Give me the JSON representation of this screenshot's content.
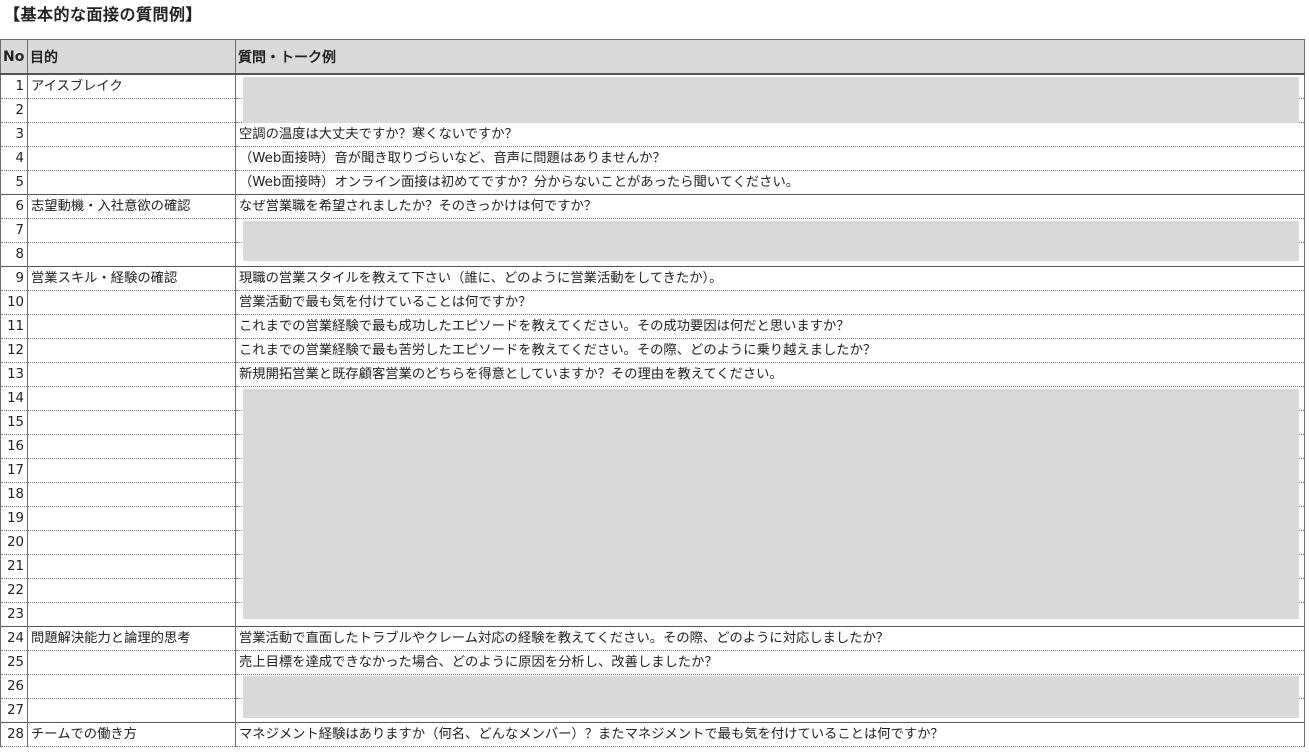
{
  "title": "【基本的な面接の質問例】",
  "table": {
    "headers": [
      "No",
      "目的",
      "質問・トーク例"
    ],
    "rows": [
      {
        "no": "1",
        "purpose": "アイスブレイク",
        "question": "",
        "group_start": true
      },
      {
        "no": "2",
        "purpose": "",
        "question": ""
      },
      {
        "no": "3",
        "purpose": "",
        "question": "空調の温度は大丈夫ですか？寒くないですか？"
      },
      {
        "no": "4",
        "purpose": "",
        "question": "（Web面接時）音が聞き取りづらいなど、音声に問題はありませんか？"
      },
      {
        "no": "5",
        "purpose": "",
        "question": "（Web面接時）オンライン面接は初めてですか？分からないことがあったら聞いてください。"
      },
      {
        "no": "6",
        "purpose": "志望動機・入社意欲の確認",
        "question": "なぜ営業職を希望されましたか？そのきっかけは何ですか？",
        "group_start": true
      },
      {
        "no": "7",
        "purpose": "",
        "question": ""
      },
      {
        "no": "8",
        "purpose": "",
        "question": ""
      },
      {
        "no": "9",
        "purpose": "営業スキル・経験の確認",
        "question": "現職の営業スタイルを教えて下さい（誰に、どのように営業活動をしてきたか）。",
        "group_start": true
      },
      {
        "no": "10",
        "purpose": "",
        "question": "営業活動で最も気を付けていることは何ですか？"
      },
      {
        "no": "11",
        "purpose": "",
        "question": "これまでの営業経験で最も成功したエピソードを教えてください。その成功要因は何だと思いますか？"
      },
      {
        "no": "12",
        "purpose": "",
        "question": "これまでの営業経験で最も苦労したエピソードを教えてください。その際、どのように乗り越えましたか？"
      },
      {
        "no": "13",
        "purpose": "",
        "question": "新規開拓営業と既存顧客営業のどちらを得意としていますか？その理由を教えてください。"
      },
      {
        "no": "14",
        "purpose": "",
        "question": ""
      },
      {
        "no": "15",
        "purpose": "",
        "question": ""
      },
      {
        "no": "16",
        "purpose": "",
        "question": ""
      },
      {
        "no": "17",
        "purpose": "",
        "question": ""
      },
      {
        "no": "18",
        "purpose": "",
        "question": ""
      },
      {
        "no": "19",
        "purpose": "",
        "question": ""
      },
      {
        "no": "20",
        "purpose": "",
        "question": ""
      },
      {
        "no": "21",
        "purpose": "",
        "question": ""
      },
      {
        "no": "22",
        "purpose": "",
        "question": ""
      },
      {
        "no": "23",
        "purpose": "",
        "question": ""
      },
      {
        "no": "24",
        "purpose": "問題解決能力と論理的思考",
        "question": "営業活動で直面したトラブルやクレーム対応の経験を教えてください。その際、どのように対応しましたか？",
        "group_start": true
      },
      {
        "no": "25",
        "purpose": "",
        "question": "売上目標を達成できなかった場合、どのように原因を分析し、改善しましたか？"
      },
      {
        "no": "26",
        "purpose": "",
        "question": ""
      },
      {
        "no": "27",
        "purpose": "",
        "question": ""
      },
      {
        "no": "28",
        "purpose": "チームでの働き方",
        "question": "マネジメント経験はありますか（何名、どんなメンバー）？またマネジメントで最も気を付けていることは何ですか？",
        "group_start": true
      }
    ]
  }
}
